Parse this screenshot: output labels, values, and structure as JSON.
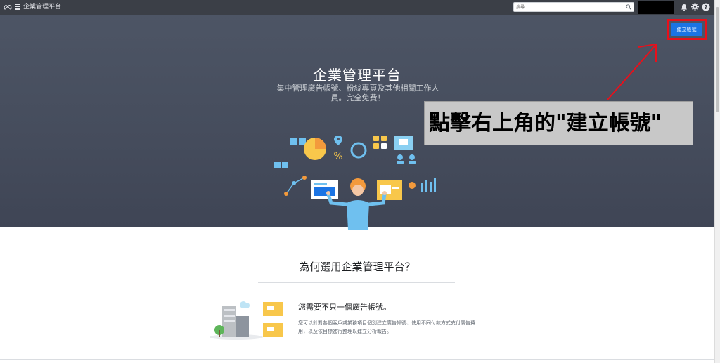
{
  "header": {
    "app_title": "企業管理平台",
    "search_placeholder": "搜尋",
    "icons": [
      "meta-logo-icon",
      "menu-icon",
      "search-icon",
      "bell-icon",
      "gear-icon",
      "help-icon"
    ]
  },
  "hero": {
    "title": "企業管理平台",
    "subtitle": "集中管理廣告帳號、粉絲專頁及其他相關工作人員。完全免費！",
    "create_button_label": "建立帳號"
  },
  "annotation": {
    "callout_text": "點擊右上角的\"建立帳號\"",
    "highlight_color": "#e8101b",
    "arrow_color": "#e8101b"
  },
  "why_section": {
    "title": "為何選用企業管理平台？",
    "feature_title": "您需要不只一個廣告帳號。",
    "feature_desc": "您可以針對各個客戶或業務項目個別建立廣告帳號、使用不同付款方式支付廣告費用，以及依目標進行整理以建立分析報告。"
  },
  "colors": {
    "topbar": "#3b3f47",
    "hero": "#4d5565",
    "primary_button": "#1b74e4"
  }
}
